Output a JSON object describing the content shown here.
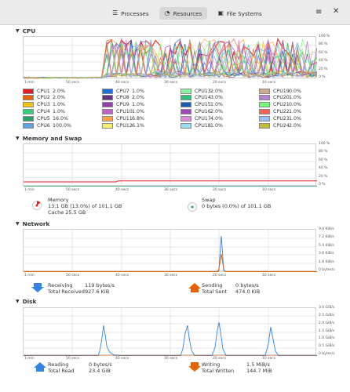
{
  "header": {
    "tabs": [
      {
        "label": "Processes",
        "icon": "list-icon",
        "active": false
      },
      {
        "label": "Resources",
        "icon": "gauge-icon",
        "active": true
      },
      {
        "label": "File Systems",
        "icon": "drive-icon",
        "active": false
      }
    ],
    "menu_icon": "hamburger-icon",
    "close_icon": "close-icon"
  },
  "time_axis": [
    "1 min",
    "50 secs",
    "40 secs",
    "30 secs",
    "20 secs",
    "10 secs"
  ],
  "cpu": {
    "title": "CPU",
    "percent_ticks": [
      "100 %",
      "80 %",
      "60 %",
      "40 %",
      "20 %",
      "0 %"
    ],
    "cores": [
      {
        "name": "CPU1",
        "value": "2.0%",
        "color": "#e01b24"
      },
      {
        "name": "CPU2",
        "value": "2.0%",
        "color": "#e66100"
      },
      {
        "name": "CPU3",
        "value": "1.0%",
        "color": "#f5c211"
      },
      {
        "name": "CPU4",
        "value": "1.0%",
        "color": "#33d17a"
      },
      {
        "name": "CPU5",
        "value": "16.0%",
        "color": "#26a269"
      },
      {
        "name": "CPU6",
        "value": "100.0%",
        "color": "#62a0ea"
      },
      {
        "name": "CPU7",
        "value": "1.0%",
        "color": "#1c71d8"
      },
      {
        "name": "CPU8",
        "value": "2.0%",
        "color": "#613583"
      },
      {
        "name": "CPU9",
        "value": "1.0%",
        "color": "#9141ac"
      },
      {
        "name": "CPU10",
        "value": "1.0%",
        "color": "#c061cb"
      },
      {
        "name": "CPU11",
        "value": "6.8%",
        "color": "#ffa348"
      },
      {
        "name": "CPU12",
        "value": "6.1%",
        "color": "#f9f06b"
      },
      {
        "name": "CPU13",
        "value": "2.0%",
        "color": "#8ff0a4"
      },
      {
        "name": "CPU14",
        "value": "3.0%",
        "color": "#2ec27e"
      },
      {
        "name": "CPU15",
        "value": "1.0%",
        "color": "#1a5fb4"
      },
      {
        "name": "CPU16",
        "value": "2.0%",
        "color": "#a347ba"
      },
      {
        "name": "CPU17",
        "value": "4.0%",
        "color": "#dc8add"
      },
      {
        "name": "CPU18",
        "value": "1.0%",
        "color": "#93ddf3"
      },
      {
        "name": "CPU19",
        "value": "0.0%",
        "color": "#cdab8f"
      },
      {
        "name": "CPU20",
        "value": "1.0%",
        "color": "#b182d6"
      },
      {
        "name": "CPU21",
        "value": "0.0%",
        "color": "#77ff77"
      },
      {
        "name": "CPU22",
        "value": "1.0%",
        "color": "#f66151"
      },
      {
        "name": "CPU23",
        "value": "1.0%",
        "color": "#99c1f1"
      },
      {
        "name": "CPU24",
        "value": "2.0%",
        "color": "#c0bf32"
      }
    ]
  },
  "memory": {
    "title": "Memory and Swap",
    "percent_ticks": [
      "100 %",
      "80 %",
      "60 %",
      "40 %",
      "20 %",
      "0 %"
    ],
    "memory_label": "Memory",
    "memory_used": "13.1 GB (13.0%) of 101.1 GB",
    "cache": "Cache 25.5 GB",
    "memory_color": "#e01b24",
    "swap_label": "Swap",
    "swap_used": "0 bytes (0.0%) of 101.1 GB",
    "swap_color": "#26a269"
  },
  "network": {
    "title": "Network",
    "ticks": [
      "9.0 KiB/s",
      "7.2 KiB/s",
      "5.4 KiB/s",
      "3.6 KiB/s",
      "1.8 KiB/s",
      "0 bytes/s"
    ],
    "receiving_label": "Receiving",
    "receiving_value": "119 bytes/s",
    "total_received_label": "Total Received",
    "total_received_value": "927.6 KiB",
    "sending_label": "Sending",
    "sending_value": "0 bytes/s",
    "total_sent_label": "Total Sent",
    "total_sent_value": "474.0 KiB",
    "receive_color": "#3584e4",
    "send_color": "#e66100"
  },
  "disk": {
    "title": "Disk",
    "ticks": [
      "3.0 GiB/s",
      "2.5 GiB/s",
      "2.0 GiB/s",
      "1.5 GiB/s",
      "1.0 GiB/s",
      "0.5 GiB/s",
      "0 bytes/s"
    ],
    "reading_label": "Reading",
    "reading_value": "0 bytes/s",
    "total_read_label": "Total Read",
    "total_read_value": "23.4 GiB",
    "writing_label": "Writing",
    "writing_value": "1.5 MiB/s",
    "total_written_label": "Total Written",
    "total_written_value": "144.7 MiB",
    "read_color": "#3584e4",
    "write_color": "#e66100"
  }
}
